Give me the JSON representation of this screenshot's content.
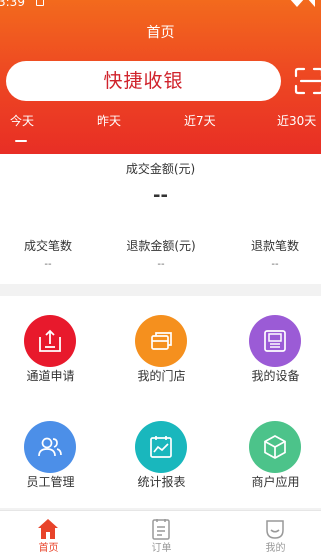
{
  "status_bar": {
    "time": "3:39"
  },
  "header": {
    "title": "首页",
    "quick_pay_label": "快捷收银",
    "accent_color": "#ee4a22"
  },
  "date_tabs": [
    {
      "label": "今天",
      "selected": true
    },
    {
      "label": "昨天",
      "selected": false
    },
    {
      "label": "近7天",
      "selected": false
    },
    {
      "label": "近30天",
      "selected": false
    }
  ],
  "summary": {
    "amount_label": "成交金额(元)",
    "amount_value": "--",
    "stats": [
      {
        "label": "成交笔数",
        "value": "--"
      },
      {
        "label": "退款金额(元)",
        "value": "--"
      },
      {
        "label": "退款笔数",
        "value": "--"
      }
    ]
  },
  "grid": [
    {
      "label": "通道申请",
      "icon": "upload-doc-icon",
      "color": "#e8192c"
    },
    {
      "label": "我的门店",
      "icon": "store-cards-icon",
      "color": "#f5901e"
    },
    {
      "label": "我的设备",
      "icon": "device-icon",
      "color": "#9b5bd6"
    },
    {
      "label": "员工管理",
      "icon": "staff-icon",
      "color": "#4c8fe8"
    },
    {
      "label": "统计报表",
      "icon": "chart-icon",
      "color": "#19b7bd"
    },
    {
      "label": "商户应用",
      "icon": "cube-icon",
      "color": "#4cc38a"
    }
  ],
  "tabbar": [
    {
      "label": "首页",
      "icon": "home-icon",
      "active": true
    },
    {
      "label": "订单",
      "icon": "order-icon",
      "active": false
    },
    {
      "label": "我的",
      "icon": "profile-icon",
      "active": false
    }
  ]
}
